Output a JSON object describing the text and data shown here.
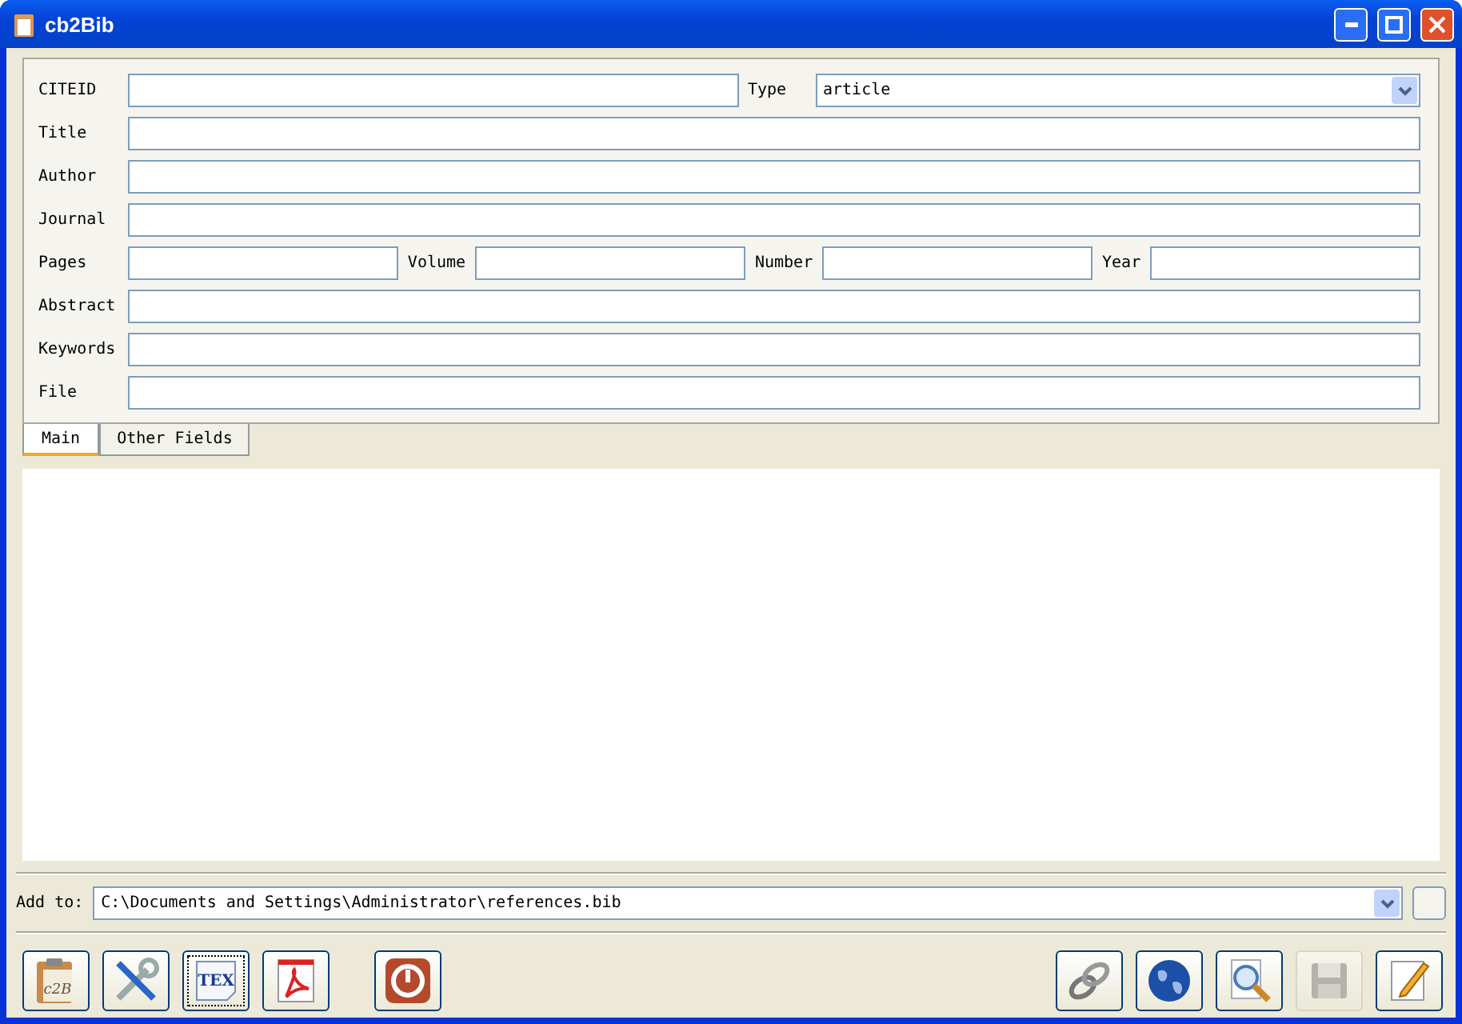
{
  "window": {
    "title": "cb2Bib"
  },
  "form": {
    "citeid": {
      "label": "CITEID"
    },
    "type": {
      "label": "Type",
      "value": "article"
    },
    "rows": [
      {
        "label": "Title"
      },
      {
        "label": "Author"
      },
      {
        "label": "Journal"
      }
    ],
    "pages": [
      {
        "label": "Pages"
      },
      {
        "label": "Volume"
      },
      {
        "label": "Number"
      },
      {
        "label": "Year"
      }
    ],
    "rows2": [
      {
        "label": "Abstract"
      },
      {
        "label": "Keywords"
      },
      {
        "label": "File"
      }
    ]
  },
  "tabs": [
    {
      "label": "Main",
      "selected": true
    },
    {
      "label": "Other Fields",
      "selected": false
    }
  ],
  "add_to": {
    "label": "Add to:",
    "value": "C:\\Documents and Settings\\Administrator\\references.bib"
  },
  "toolbar_left": [
    {
      "kind": "clipboard",
      "icon_text": "c2B",
      "disabled": false,
      "focused": false
    },
    {
      "kind": "tools",
      "disabled": false,
      "focused": false
    },
    {
      "kind": "tex",
      "icon_text": "TEX",
      "disabled": false,
      "focused": true
    },
    {
      "kind": "pdf",
      "disabled": false,
      "focused": false
    },
    {
      "kind": "exit",
      "disabled": false,
      "focused": false
    }
  ],
  "toolbar_right": [
    {
      "kind": "link",
      "disabled": false,
      "focused": false
    },
    {
      "kind": "globe",
      "disabled": false,
      "focused": false
    },
    {
      "kind": "search",
      "disabled": false,
      "focused": false
    },
    {
      "kind": "save",
      "disabled": true,
      "focused": false
    },
    {
      "kind": "edit",
      "disabled": false,
      "focused": false
    }
  ]
}
